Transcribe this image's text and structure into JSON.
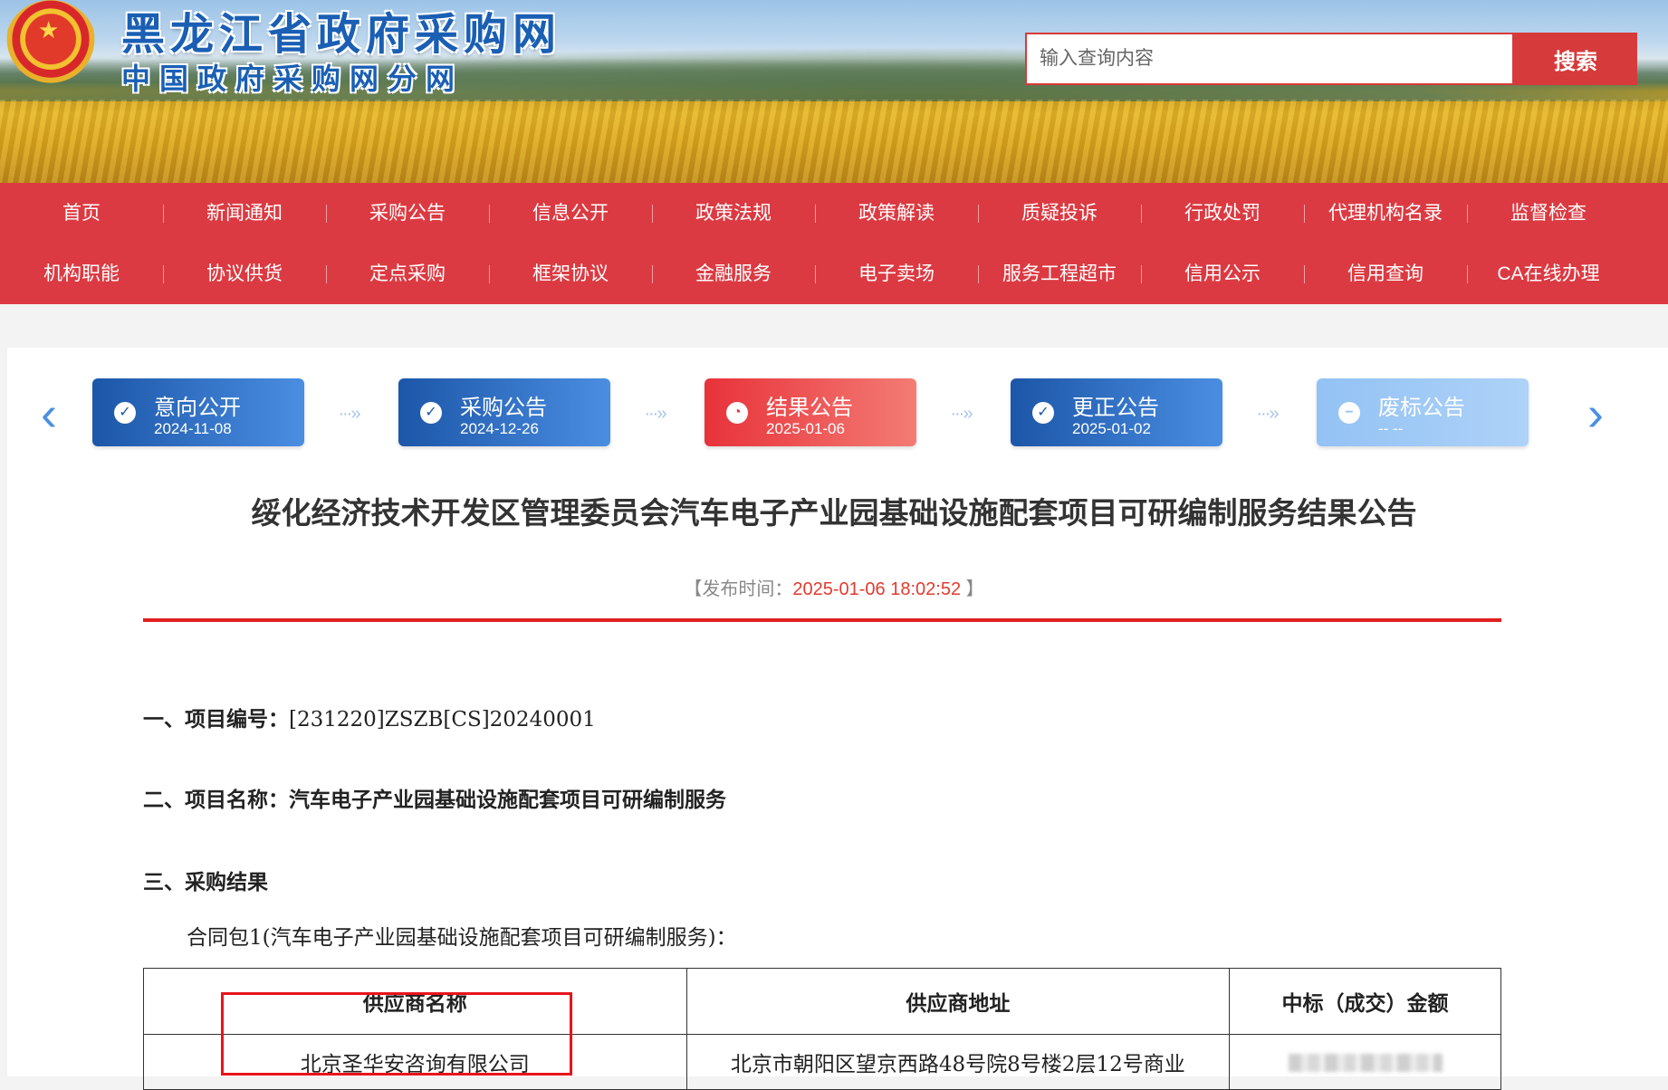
{
  "header": {
    "site_title": "黑龙江省政府采购网",
    "site_subtitle": "中国政府采购网分网",
    "search": {
      "placeholder": "输入查询内容",
      "button_label": "搜索"
    }
  },
  "nav": {
    "row1": [
      "首页",
      "新闻通知",
      "采购公告",
      "信息公开",
      "政策法规",
      "政策解读",
      "质疑投诉",
      "行政处罚",
      "代理机构名录",
      "监督检查"
    ],
    "row2": [
      "机构职能",
      "协议供货",
      "定点采购",
      "框架协议",
      "金融服务",
      "电子卖场",
      "服务工程超市",
      "信用公示",
      "信用查询",
      "CA在线办理"
    ]
  },
  "steps": [
    {
      "label": "意向公开",
      "date": "2024-11-08",
      "state": "done"
    },
    {
      "label": "采购公告",
      "date": "2024-12-26",
      "state": "done"
    },
    {
      "label": "结果公告",
      "date": "2025-01-06",
      "state": "current"
    },
    {
      "label": "更正公告",
      "date": "2025-01-02",
      "state": "done"
    },
    {
      "label": "废标公告",
      "date": "-- --",
      "state": "inactive"
    }
  ],
  "article": {
    "title": "绥化经济技术开发区管理委员会汽车电子产业园基础设施配套项目可研编制服务结果公告",
    "publish": {
      "open": "【",
      "label": "发布时间：",
      "time": "2025-01-06 18:02:52",
      "close": " 】"
    },
    "section1": {
      "label": "一、项目编号：",
      "value": "[231220]ZSZB[CS]20240001"
    },
    "section2": {
      "label": "二、项目名称：",
      "value": "汽车电子产业园基础设施配套项目可研编制服务"
    },
    "section3": {
      "label": "三、采购结果"
    },
    "package": "合同包1(汽车电子产业园基础设施配套项目可研编制服务)：",
    "table": {
      "headers": [
        "供应商名称",
        "供应商地址",
        "中标（成交）金额"
      ],
      "rows": [
        {
          "name": "北京圣华安咨询有限公司",
          "address": "北京市朝阳区望京西路48号院8号楼2层12号商业"
        }
      ]
    }
  },
  "colors": {
    "nav": "#dc3a42",
    "accent_red": "#e02020",
    "step_blue": "#1c56a8",
    "step_red": "#e8323a"
  }
}
